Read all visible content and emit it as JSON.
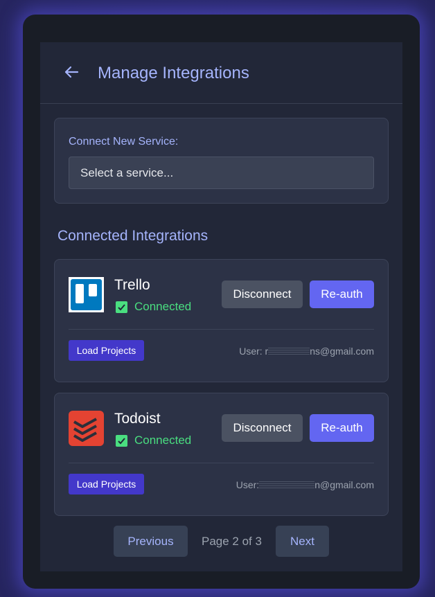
{
  "header": {
    "title": "Manage Integrations",
    "back_icon": "arrow-left-icon"
  },
  "connect": {
    "label": "Connect New Service:",
    "select_value": "Select a service..."
  },
  "section_title": "Connected Integrations",
  "integrations": [
    {
      "name": "Trello",
      "status": "Connected",
      "disconnect_label": "Disconnect",
      "reauth_label": "Re-auth",
      "load_label": "Load Projects",
      "user_prefix": "User: r",
      "user_suffix": "ns@gmail.com",
      "logo_color": "#0079bf"
    },
    {
      "name": "Todoist",
      "status": "Connected",
      "disconnect_label": "Disconnect",
      "reauth_label": "Re-auth",
      "load_label": "Load Projects",
      "user_prefix": "User:",
      "user_suffix": "n@gmail.com",
      "logo_color": "#e44332"
    }
  ],
  "pagination": {
    "previous": "Previous",
    "page_info": "Page 2 of 3",
    "next": "Next"
  },
  "colors": {
    "accent": "#6366f1",
    "title": "#a5b4fc",
    "connected": "#4ade80"
  }
}
